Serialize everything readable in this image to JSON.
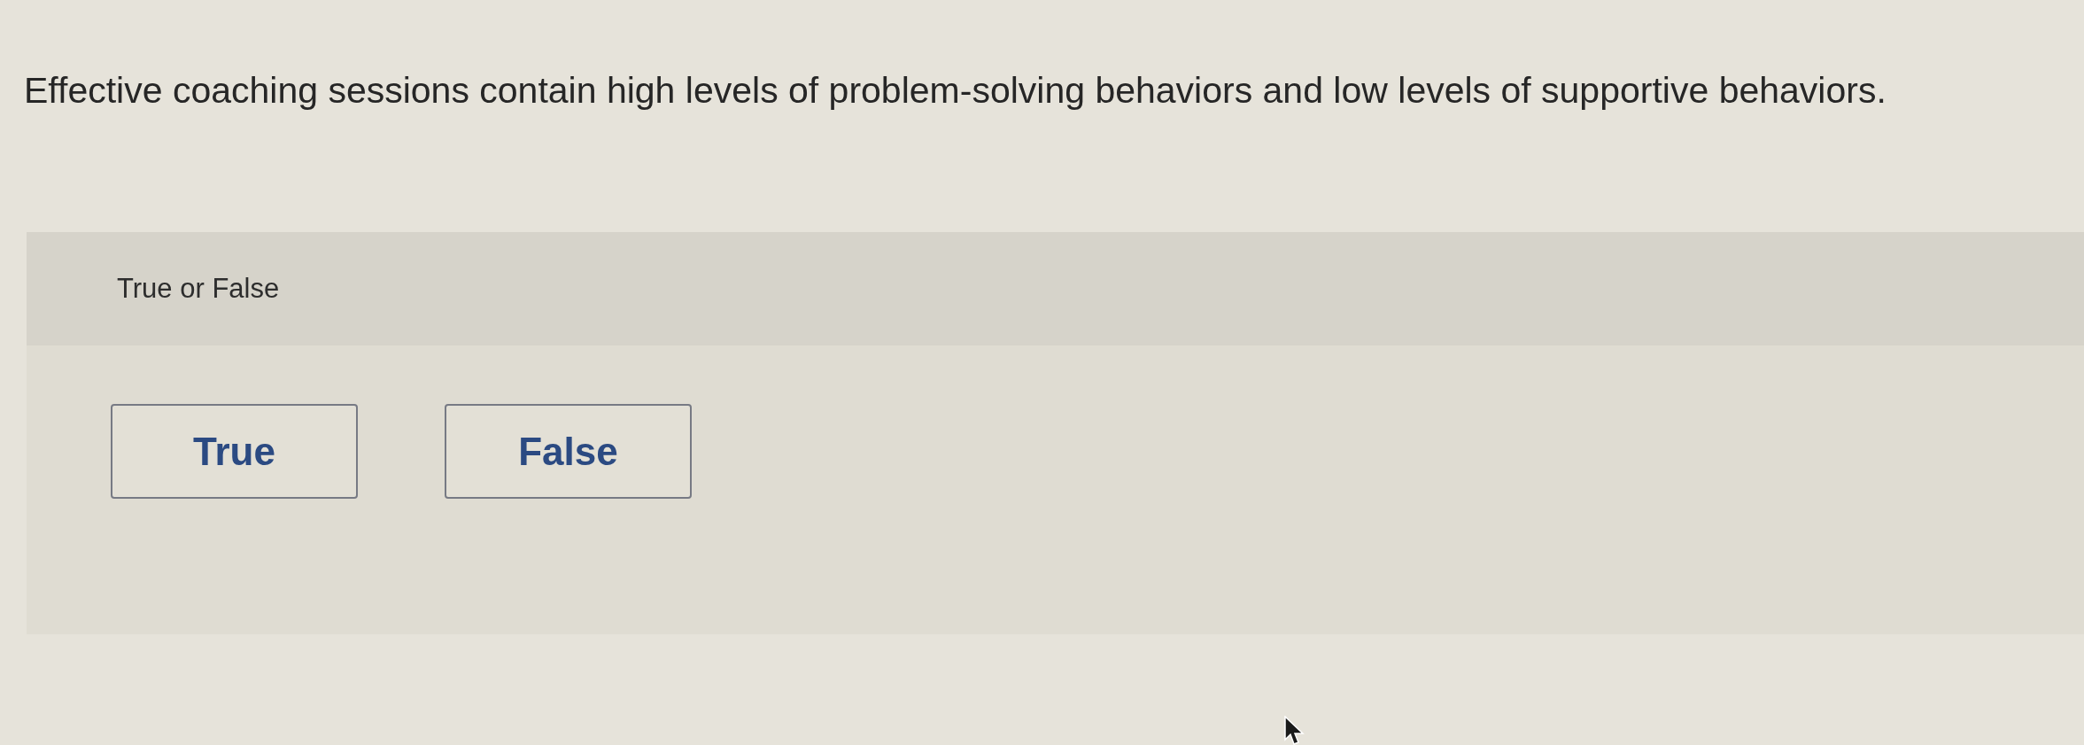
{
  "question": {
    "text": "Effective coaching sessions contain high levels of problem-solving behaviors and low levels of supportive behaviors."
  },
  "answer_panel": {
    "label": "True or False",
    "options": [
      {
        "label": "True",
        "selected": false
      },
      {
        "label": "False",
        "selected": false
      }
    ]
  }
}
